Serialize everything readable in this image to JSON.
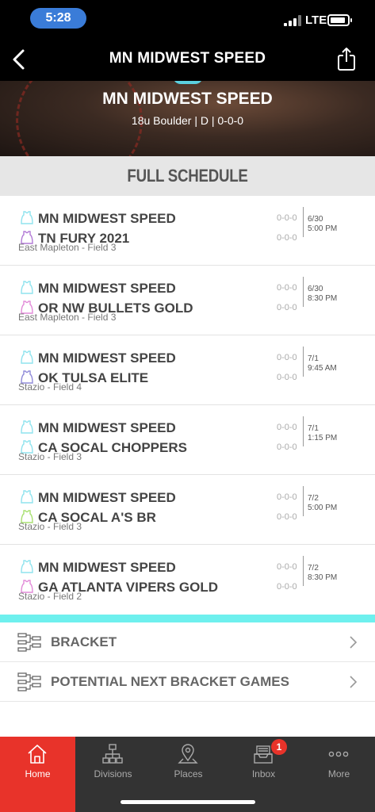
{
  "status": {
    "time": "5:28",
    "network": "LTE"
  },
  "nav": {
    "title": "MN MIDWEST SPEED"
  },
  "banner": {
    "team": "MN MIDWEST SPEED",
    "subtitle": "18u Boulder | D | 0-0-0"
  },
  "schedule": {
    "heading": "FULL SCHEDULE",
    "games": [
      {
        "team1": "MN MIDWEST SPEED",
        "team2": "TN FURY 2021",
        "location": "East Mapleton - Field 3",
        "record1": "0-0-0",
        "record2": "0-0-0",
        "date": "6/30",
        "time": "5:00 PM",
        "jersey1_color": "#8fe3ee",
        "jersey2_color": "#b27ad6"
      },
      {
        "team1": "MN MIDWEST SPEED",
        "team2": "OR NW BULLETS GOLD",
        "location": "East Mapleton - Field 3",
        "record1": "0-0-0",
        "record2": "0-0-0",
        "date": "6/30",
        "time": "8:30 PM",
        "jersey1_color": "#8fe3ee",
        "jersey2_color": "#e28ad8"
      },
      {
        "team1": "MN MIDWEST SPEED",
        "team2": "OK TULSA ELITE",
        "location": "Stazio - Field 4",
        "record1": "0-0-0",
        "record2": "0-0-0",
        "date": "7/1",
        "time": "9:45 AM",
        "jersey1_color": "#8fe3ee",
        "jersey2_color": "#8f8ad8"
      },
      {
        "team1": "MN MIDWEST SPEED",
        "team2": "CA SOCAL CHOPPERS",
        "location": "Stazio - Field 3",
        "record1": "0-0-0",
        "record2": "0-0-0",
        "date": "7/1",
        "time": "1:15 PM",
        "jersey1_color": "#8fe3ee",
        "jersey2_color": "#8fe3ee"
      },
      {
        "team1": "MN MIDWEST SPEED",
        "team2": "CA SOCAL A'S BR",
        "location": "Stazio - Field 3",
        "record1": "0-0-0",
        "record2": "0-0-0",
        "date": "7/2",
        "time": "5:00 PM",
        "jersey1_color": "#8fe3ee",
        "jersey2_color": "#a8e070"
      },
      {
        "team1": "MN MIDWEST SPEED",
        "team2": "GA ATLANTA VIPERS GOLD",
        "location": "Stazio - Field 2",
        "record1": "0-0-0",
        "record2": "0-0-0",
        "date": "7/2",
        "time": "8:30 PM",
        "jersey1_color": "#8fe3ee",
        "jersey2_color": "#e28ad8"
      }
    ]
  },
  "links": [
    {
      "label": "BRACKET"
    },
    {
      "label": "POTENTIAL NEXT BRACKET GAMES"
    }
  ],
  "tabs": [
    {
      "label": "Home",
      "icon": "home-icon",
      "active": true
    },
    {
      "label": "Divisions",
      "icon": "divisions-icon"
    },
    {
      "label": "Places",
      "icon": "places-icon"
    },
    {
      "label": "Inbox",
      "icon": "inbox-icon",
      "badge": "1"
    },
    {
      "label": "More",
      "icon": "more-icon"
    }
  ],
  "colors": {
    "accent": "#e8332a",
    "cyan": "#6ef0ee",
    "tabbar": "#333333"
  }
}
